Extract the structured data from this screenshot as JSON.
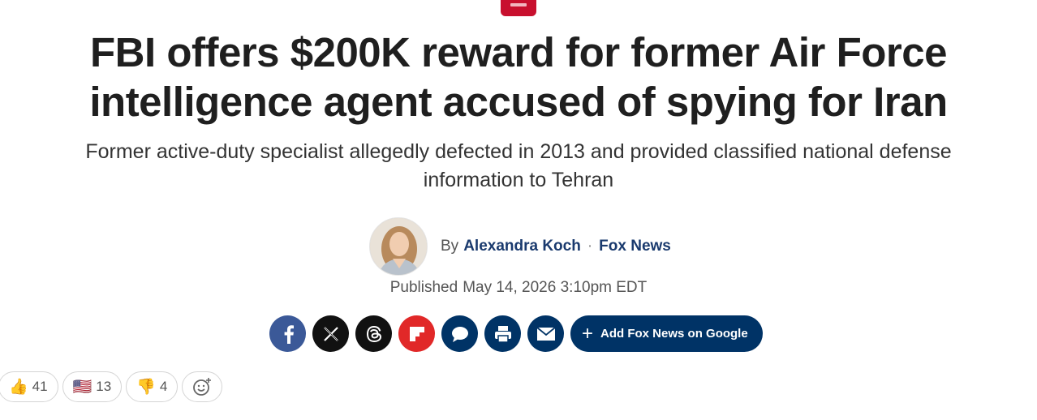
{
  "article": {
    "headline": "FBI offers $200K reward for former Air Force intelligence agent accused of spying for Iran",
    "subhead": "Former active-duty specialist allegedly defected in 2013 and provided classified national defense information to Tehran",
    "byline_prefix": "By",
    "author": "Alexandra Koch",
    "separator": "·",
    "outlet": "Fox News",
    "published_label": "Published",
    "published_date": "May 14, 2026 3:10pm EDT"
  },
  "share": {
    "add_google_label": "Add Fox News on Google",
    "icons": [
      "facebook-icon",
      "x-icon",
      "threads-icon",
      "flipboard-icon",
      "comment-icon",
      "print-icon",
      "email-icon"
    ]
  },
  "reactions": [
    {
      "emoji": "👍",
      "count": "41"
    },
    {
      "emoji": "🇺🇸",
      "count": "13"
    },
    {
      "emoji": "👎",
      "count": "4"
    }
  ],
  "colors": {
    "brand_navy": "#003366",
    "author_link": "#1a3a6e",
    "facebook": "#3b5998",
    "flipboard": "#e12828",
    "badge_red": "#c8102e"
  }
}
